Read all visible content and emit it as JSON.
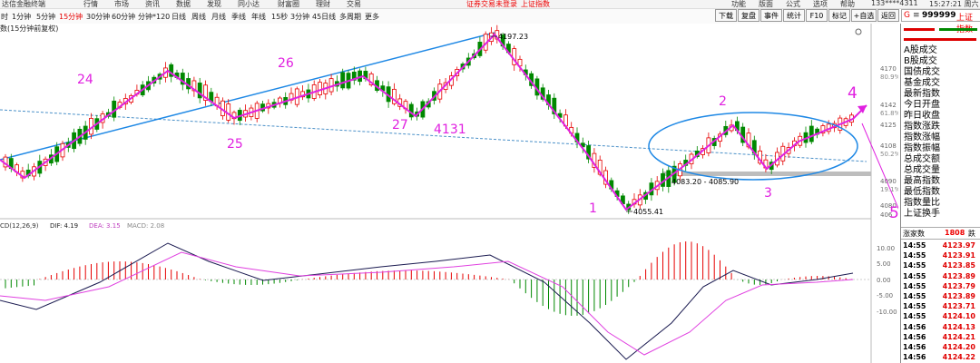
{
  "menubar": {
    "app": "达信金融终端",
    "items": [
      "行情",
      "市场",
      "资讯",
      "数据",
      "发现",
      "同小达",
      "财富圈",
      "理财",
      "交易"
    ],
    "notice": "证券交易未登录",
    "notice2": "上证指数",
    "right_items": [
      "功能",
      "版面",
      "公式",
      "选项",
      "帮助"
    ],
    "account": "133****4311",
    "clock": "15:27:21 周六"
  },
  "periods": [
    "时",
    "1分钟",
    "5分钟",
    "15分钟",
    "30分钟",
    "60分钟",
    "分钟*120",
    "日线",
    "周线",
    "月线",
    "季线",
    "年线",
    "15秒",
    "3分钟",
    "45日线",
    "多周期",
    "更多"
  ],
  "active_period": "15分钟",
  "chart_title": "数(15分钟前复权)",
  "toolbar_buttons": [
    "下载",
    "复盘",
    "事件",
    "统计",
    "F10",
    "标记",
    "+自选",
    "返回"
  ],
  "price_axis": {
    "labels": [
      "4170",
      "80.9%",
      "4142",
      "61.8%",
      "4125",
      "4108",
      "50.2%",
      "4090",
      "19.1%",
      "4080",
      "406"
    ]
  },
  "annotations": {
    "high": "4197.23",
    "low": "4055.41",
    "range": "4083.20 - 4085.90",
    "numbers": [
      "24",
      "25",
      "26",
      "27",
      "4131",
      "1",
      "2",
      "3",
      "4",
      "5"
    ]
  },
  "macd": {
    "label": "CD(12,26,9)",
    "dif_label": "DIF: 4.19",
    "dea_label": "DEA: 3.15",
    "macd_label": "MACD: 2.08",
    "axis": [
      "10.00",
      "5.00",
      "0.00",
      "-5.00",
      "-10.00"
    ]
  },
  "right_panel": {
    "code_prefix": "G",
    "code_icon": "≡",
    "code": "999999",
    "name": "上证指数",
    "items": [
      "A股成交",
      "B股成交",
      "国债成交",
      "基金成交",
      "最新指数",
      "今日开盘",
      "昨日收盘",
      "指数涨跌",
      "指数涨幅",
      "指数振幅",
      "总成交额",
      "总成交量",
      "最高指数",
      "最低指数",
      "指数量比",
      "上证换手"
    ],
    "updown_label": "涨家数",
    "updown_value": "1808",
    "updown_suffix": "跌",
    "ticks": [
      {
        "time": "14:55",
        "price": "4123.97"
      },
      {
        "time": "14:55",
        "price": "4123.91"
      },
      {
        "time": "14:55",
        "price": "4123.85"
      },
      {
        "time": "14:55",
        "price": "4123.89"
      },
      {
        "time": "14:55",
        "price": "4123.79"
      },
      {
        "time": "14:55",
        "price": "4123.89"
      },
      {
        "time": "14:55",
        "price": "4123.71"
      },
      {
        "time": "14:55",
        "price": "4124.10"
      },
      {
        "time": "14:56",
        "price": "4124.13"
      },
      {
        "time": "14:56",
        "price": "4124.21"
      },
      {
        "time": "14:56",
        "price": "4124.20"
      },
      {
        "time": "14:56",
        "price": "4124.22"
      }
    ]
  },
  "colors": {
    "up": "#e60000",
    "down": "#008800",
    "annot": "#e020e0",
    "trend": "#1e88e5"
  }
}
